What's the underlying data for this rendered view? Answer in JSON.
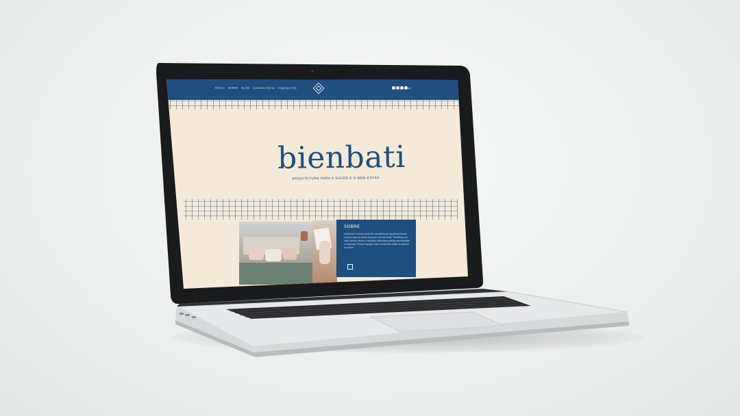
{
  "website": {
    "nav": {
      "links": [
        "INÍCIO",
        "SOBRE",
        "BLOG",
        "CONSULTORIA",
        "CONTACTOS"
      ],
      "lang": "pt"
    },
    "hero": {
      "brand": "bienbati",
      "tagline": "ARQUITETURA PARA A SAÚDE E O BEM-ESTAR"
    },
    "about": {
      "title": "SOBRE",
      "text": "A bienbati é uma empresa de consultoria de arquitetura focada na promoção da saúde humana e da bem-estar. Trabalhamos a mais recente ciência a identificar dinâmicas práticas para famílias e empresas. Porque espaços mais conscientes estão ao alcance de todos!"
    }
  },
  "colors": {
    "brand_blue": "#1e4f7f",
    "cream": "#f5ead8",
    "laptop_silver": "#d9dbdc",
    "bezel": "#1a1b1d"
  }
}
